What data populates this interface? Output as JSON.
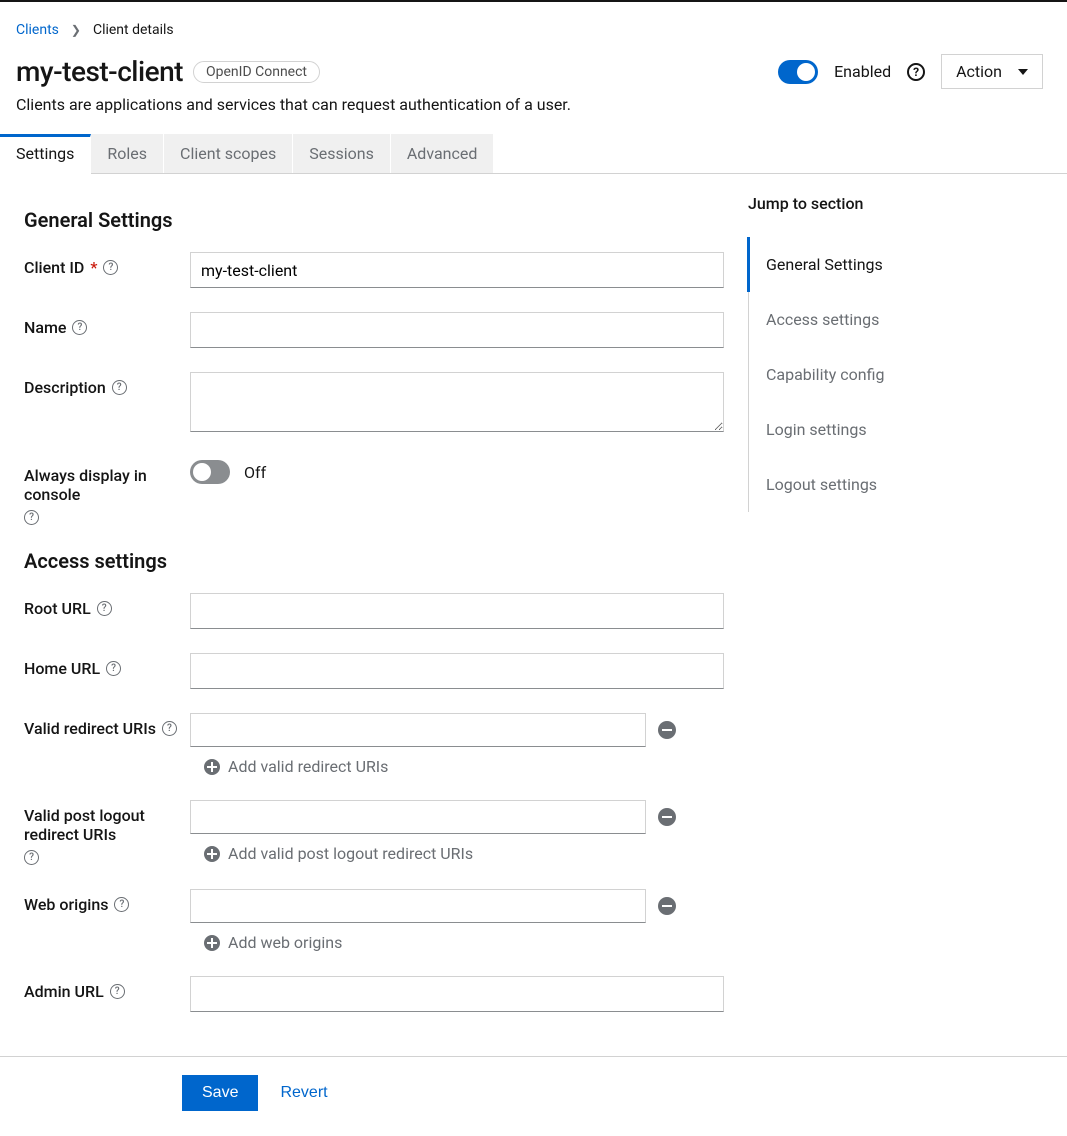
{
  "breadcrumb": {
    "parent": "Clients",
    "current": "Client details"
  },
  "header": {
    "title": "my-test-client",
    "badge": "OpenID Connect",
    "enabled_label": "Enabled",
    "action_label": "Action",
    "subtitle": "Clients are applications and services that can request authentication of a user."
  },
  "tabs": [
    "Settings",
    "Roles",
    "Client scopes",
    "Sessions",
    "Advanced"
  ],
  "sections": {
    "general": {
      "title": "General Settings",
      "client_id": {
        "label": "Client ID",
        "value": "my-test-client"
      },
      "name": {
        "label": "Name",
        "value": ""
      },
      "description": {
        "label": "Description",
        "value": ""
      },
      "always_display": {
        "label": "Always display in console",
        "status": "Off"
      }
    },
    "access": {
      "title": "Access settings",
      "root_url": {
        "label": "Root URL",
        "value": ""
      },
      "home_url": {
        "label": "Home URL",
        "value": ""
      },
      "redirect_uris": {
        "label": "Valid redirect URIs",
        "add_text": "Add valid redirect URIs"
      },
      "post_logout_uris": {
        "label": "Valid post logout redirect URIs",
        "add_text": "Add valid post logout redirect URIs"
      },
      "web_origins": {
        "label": "Web origins",
        "add_text": "Add web origins"
      },
      "admin_url": {
        "label": "Admin URL",
        "value": ""
      }
    }
  },
  "jump": {
    "title": "Jump to section",
    "items": [
      "General Settings",
      "Access settings",
      "Capability config",
      "Login settings",
      "Logout settings"
    ]
  },
  "footer": {
    "save": "Save",
    "revert": "Revert"
  }
}
